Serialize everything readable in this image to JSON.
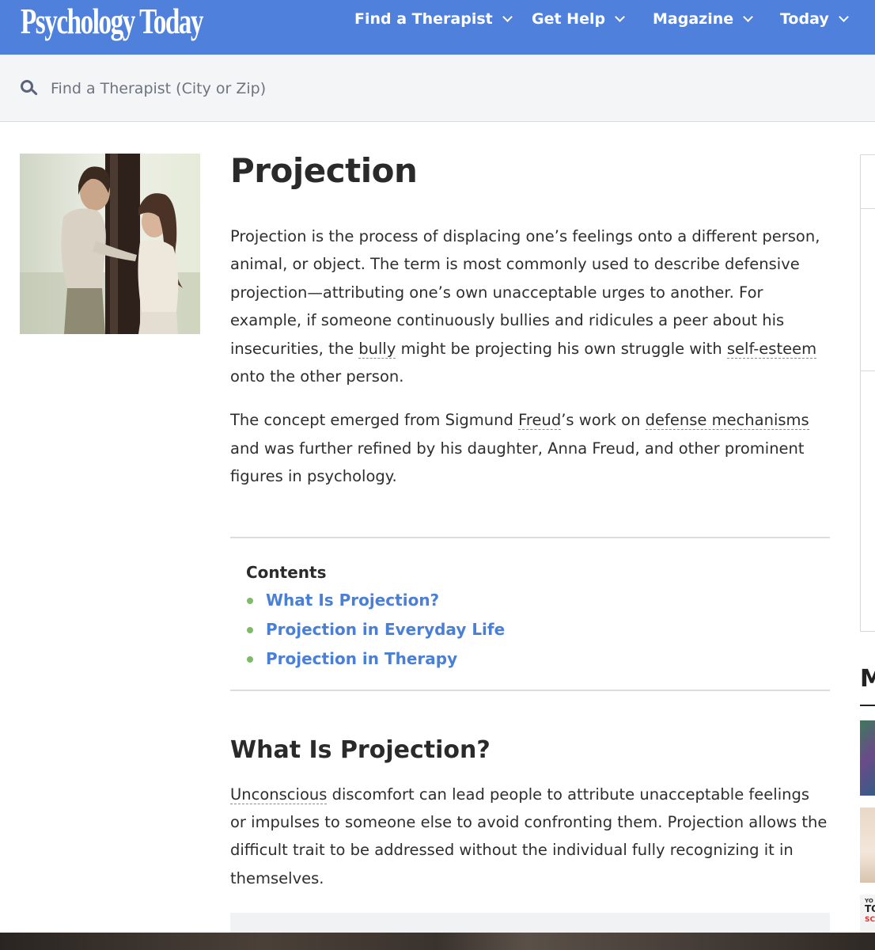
{
  "header": {
    "logo_text": "Psychology Today",
    "nav": [
      {
        "label": "Find a Therapist"
      },
      {
        "label": "Get Help"
      },
      {
        "label": "Magazine"
      },
      {
        "label": "Today"
      }
    ]
  },
  "search": {
    "placeholder": "Find a Therapist (City or Zip)",
    "value": ""
  },
  "article": {
    "title": "Projection",
    "p1": {
      "t1": "Projection is the process of displacing one’s feelings onto a different person, animal, or object. The term is most commonly used to describe defensive projection—attributing one’s own unacceptable urges to another. For example, if someone continuously bullies and ridicules a peer about his insecurities, the ",
      "term1": "bully",
      "t2": " might be projecting his own struggle with ",
      "term2": "self-esteem",
      "t3": " onto the other person."
    },
    "p2": {
      "t1": "The concept emerged from Sigmund ",
      "term1": "Freud",
      "t2": "’s work on ",
      "term2": "defense mechanisms",
      "t3": " and was further refined by his daughter, Anna Freud, and other prominent figures in psychology."
    },
    "contents": {
      "heading": "Contents",
      "items": [
        {
          "label": "What Is Projection?"
        },
        {
          "label": "Projection in Everyday Life"
        },
        {
          "label": "Projection in Therapy"
        }
      ]
    },
    "section1": {
      "heading": "What Is Projection?",
      "term1": "Unconscious",
      "t1": " discomfort can lead people to attribute unacceptable feelings or impulses to someone else to avoid confronting them. Projection allows the difficult trait to be addressed without the individual fully recognizing it in themselves."
    }
  },
  "sidebar": {
    "section_letter": "M",
    "thumb3_lines": [
      "YO",
      "TO",
      "SC"
    ]
  },
  "colors": {
    "header_bg": "#4f80dc",
    "link": "#4a7fd6",
    "bullet": "#7dbb6a",
    "search_bg": "#f4f5f7"
  },
  "icons": [
    "search-icon",
    "chevron-down-icon"
  ]
}
